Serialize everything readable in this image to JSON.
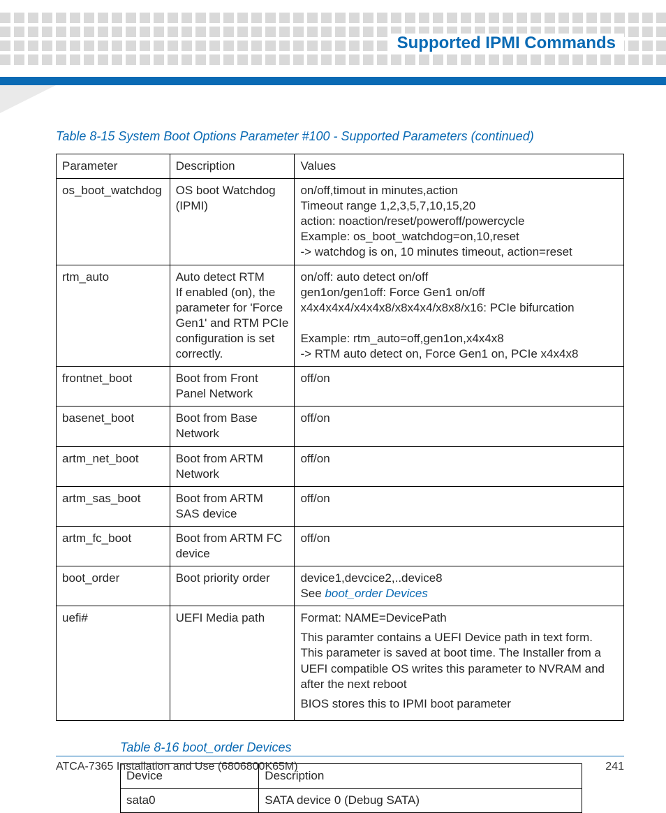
{
  "header": {
    "title": "Supported IPMI Commands"
  },
  "table1": {
    "caption": "Table 8-15 System Boot Options Parameter #100 - Supported Parameters  (continued)",
    "headers": {
      "c1": "Parameter",
      "c2": "Description",
      "c3": "Values"
    },
    "rows": [
      {
        "param": " os_boot_watchdog",
        "desc": "OS boot Watchdog (IPMI)",
        "val_lines": [
          "on/off,timout in minutes,action",
          "Timeout range 1,2,3,5,7,10,15,20",
          "action: noaction/reset/poweroff/powercycle",
          "Example: os_boot_watchdog=on,10,reset",
          "-> watchdog is on, 10 minutes timeout, action=reset"
        ]
      },
      {
        "param": "rtm_auto",
        "desc": "Auto detect RTM\nIf enabled (on), the parameter for 'Force Gen1' and RTM PCIe configuration is set correctly.",
        "val_lines": [
          "on/off: auto detect on/off",
          "gen1on/gen1off: Force Gen1 on/off",
          "x4x4x4x4/x4x4x8/x8x4x4/x8x8/x16: PCIe bifurcation",
          "",
          "Example: rtm_auto=off,gen1on,x4x4x8",
          "-> RTM auto detect on, Force Gen1 on, PCIe x4x4x8"
        ]
      },
      {
        "param": "frontnet_boot",
        "desc": "Boot from Front Panel Network",
        "val_lines": [
          "off/on"
        ]
      },
      {
        "param": "basenet_boot",
        "desc": "Boot from Base Network",
        "val_lines": [
          "off/on"
        ]
      },
      {
        "param": " artm_net_boot",
        "desc": "Boot from ARTM Network",
        "val_lines": [
          "off/on"
        ]
      },
      {
        "param": "artm_sas_boot",
        "desc": "Boot from ARTM SAS device",
        "val_lines": [
          "off/on"
        ]
      },
      {
        "param": "artm_fc_boot",
        "desc": "Boot from ARTM FC device",
        "val_lines": [
          "off/on"
        ]
      },
      {
        "param": " boot_order",
        "desc": "Boot priority order",
        "val_prefix": "device1,devcice2,..device8\nSee ",
        "val_link": "boot_order Devices"
      },
      {
        "param": "uefi#",
        "desc": "UEFI Media path",
        "val_paras": [
          "Format: NAME=DevicePath",
          "This paramter contains a UEFI Device path in text form. This parameter is saved at boot time. The Installer from a UEFI compatible OS writes this parameter to NVRAM and after the next reboot",
          "BIOS stores this to IPMI boot parameter"
        ]
      }
    ]
  },
  "table2": {
    "caption": "Table 8-16 boot_order Devices",
    "headers": {
      "c1": "Device",
      "c2": "Description"
    },
    "rows": [
      {
        "device": "sata0",
        "desc": "SATA device 0 (Debug SATA)"
      }
    ]
  },
  "footer": {
    "left": "ATCA-7365 Installation and Use (6806800K65M)",
    "right": "241"
  }
}
